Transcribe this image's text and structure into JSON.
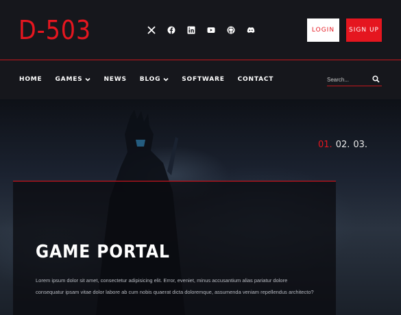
{
  "header": {
    "logo": "D-503",
    "socials": [
      "x-icon",
      "facebook-icon",
      "linkedin-icon",
      "youtube-icon",
      "github-icon",
      "discord-icon"
    ],
    "login_label": "LOGIN",
    "signup_label": "SIGN UP"
  },
  "nav": {
    "items": [
      {
        "label": "HOME",
        "dropdown": false
      },
      {
        "label": "GAMES",
        "dropdown": true
      },
      {
        "label": "NEWS",
        "dropdown": false
      },
      {
        "label": "BLOG",
        "dropdown": true
      },
      {
        "label": "SOFTWARE",
        "dropdown": false
      },
      {
        "label": "CONTACT",
        "dropdown": false
      }
    ],
    "search_placeholder": "Search..."
  },
  "hero": {
    "slides": [
      "01.",
      "02.",
      "03."
    ],
    "active_slide": 0,
    "title": "GAME PORTAL",
    "text": "Lorem ipsum dolor sit amet, consectetur adipisicing elit. Error, eveniet, minus accusantium alias pariatur dolore consequatur ipsam vitae dolor labore ab cum nobis quaerat dicta doloremque, assumenda veniam repellendus architecto?"
  },
  "colors": {
    "accent": "#e5161f",
    "background": "#16171c",
    "text": "#ffffff"
  }
}
